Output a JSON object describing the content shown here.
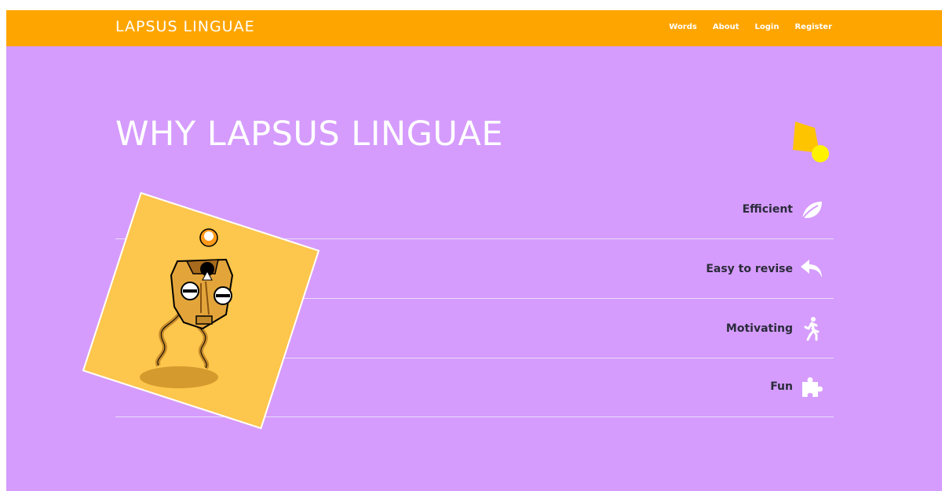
{
  "nav": {
    "brand": "LAPSUS LINGUAE",
    "links": [
      "Words",
      "About",
      "Login",
      "Register"
    ]
  },
  "hero": {
    "title": "WHY LAPSUS LINGUAE"
  },
  "features": [
    {
      "label": "Efficient",
      "icon": "leaf-icon"
    },
    {
      "label": "Easy to revise",
      "icon": "reply-arrow-icon"
    },
    {
      "label": "Motivating",
      "icon": "walking-person-icon"
    },
    {
      "label": "Fun",
      "icon": "puzzle-piece-icon"
    }
  ],
  "colors": {
    "nav_background": "#ffa500",
    "page_background": "#d59cfd",
    "card_background": "#fdc64c",
    "deco_shape": "#ffc400",
    "deco_dot": "#fff200"
  }
}
